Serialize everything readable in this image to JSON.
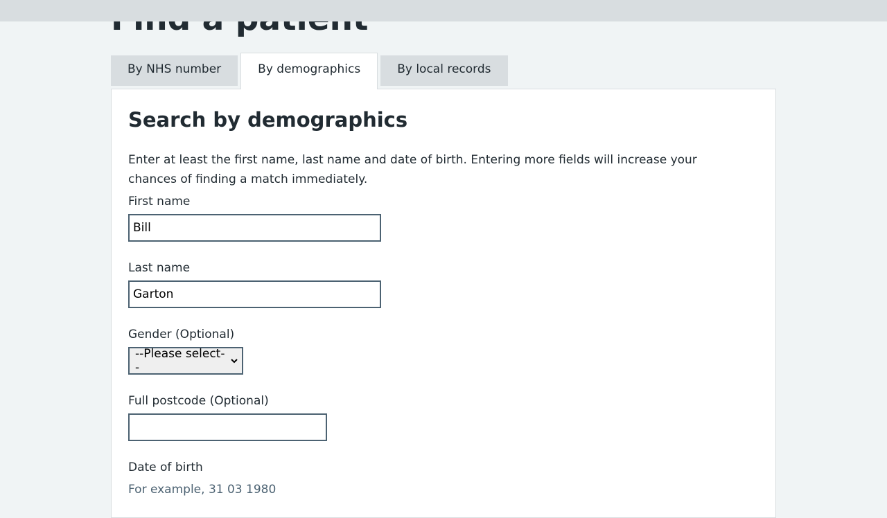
{
  "page": {
    "title": "Find a patient"
  },
  "tabs": [
    {
      "label": "By NHS number",
      "active": false
    },
    {
      "label": "By demographics",
      "active": true
    },
    {
      "label": "By local records",
      "active": false
    }
  ],
  "panel": {
    "heading": "Search by demographics",
    "intro": "Enter at least the first name, last name and date of birth. Entering more fields will increase your chances of finding a match immediately."
  },
  "form": {
    "first_name": {
      "label": "First name",
      "value": "Bill"
    },
    "last_name": {
      "label": "Last name",
      "value": "Garton"
    },
    "gender": {
      "label": "Gender (Optional)",
      "selected": "--Please select--"
    },
    "postcode": {
      "label": "Full postcode (Optional)",
      "value": ""
    },
    "dob": {
      "label": "Date of birth",
      "hint": "For example, 31 03 1980"
    }
  },
  "icons": {
    "select_chevron": "chevron-down-icon"
  },
  "colors": {
    "page_background": "#f0f4f5",
    "tab_inactive": "#d8dde0",
    "input_border": "#4c6272",
    "text": "#212b32",
    "hint": "#4c6272"
  }
}
